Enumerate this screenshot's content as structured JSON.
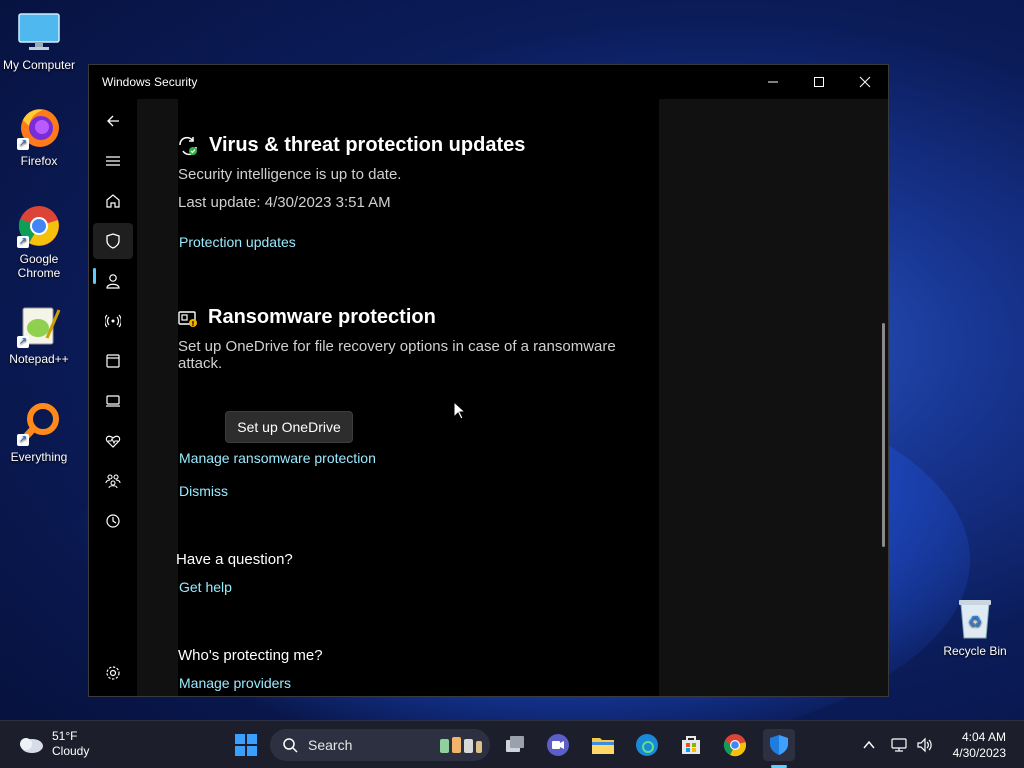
{
  "desktop": {
    "icons": [
      {
        "label": "My Computer"
      },
      {
        "label": "Firefox"
      },
      {
        "label": "Google Chrome"
      },
      {
        "label": "Notepad++"
      },
      {
        "label": "Everything"
      },
      {
        "label": "Recycle Bin"
      }
    ]
  },
  "window": {
    "title": "Windows Security",
    "controls": {
      "minimize": "—",
      "maximize": "☐",
      "close": "✕"
    }
  },
  "nav": {
    "items": [
      "back-icon",
      "menu-icon",
      "home-icon",
      "shield-icon",
      "account-icon",
      "firewall-icon",
      "app-browser-icon",
      "device-security-icon",
      "health-icon",
      "family-icon",
      "history-icon",
      "settings-icon"
    ],
    "selected": "shield-icon"
  },
  "updates": {
    "heading": "Virus & threat protection updates",
    "status": "Security intelligence is up to date.",
    "last_update": "Last update: 4/30/2023 3:51 AM",
    "link": "Protection updates"
  },
  "ransomware": {
    "heading": "Ransomware protection",
    "description": "Set up OneDrive for file recovery options in case of a ransomware attack.",
    "button": "Set up OneDrive",
    "manage_link": "Manage ransomware protection",
    "dismiss_link": "Dismiss"
  },
  "question": {
    "heading": "Have a question?",
    "link": "Get help"
  },
  "protecting": {
    "heading": "Who's protecting me?",
    "link": "Manage providers"
  },
  "taskbar": {
    "weather_temp": "51°F",
    "weather_desc": "Cloudy",
    "search_placeholder": "Search",
    "time": "4:04 AM",
    "date": "4/30/2023"
  },
  "colors": {
    "link": "#99ebff",
    "accent": "#60cdff"
  }
}
